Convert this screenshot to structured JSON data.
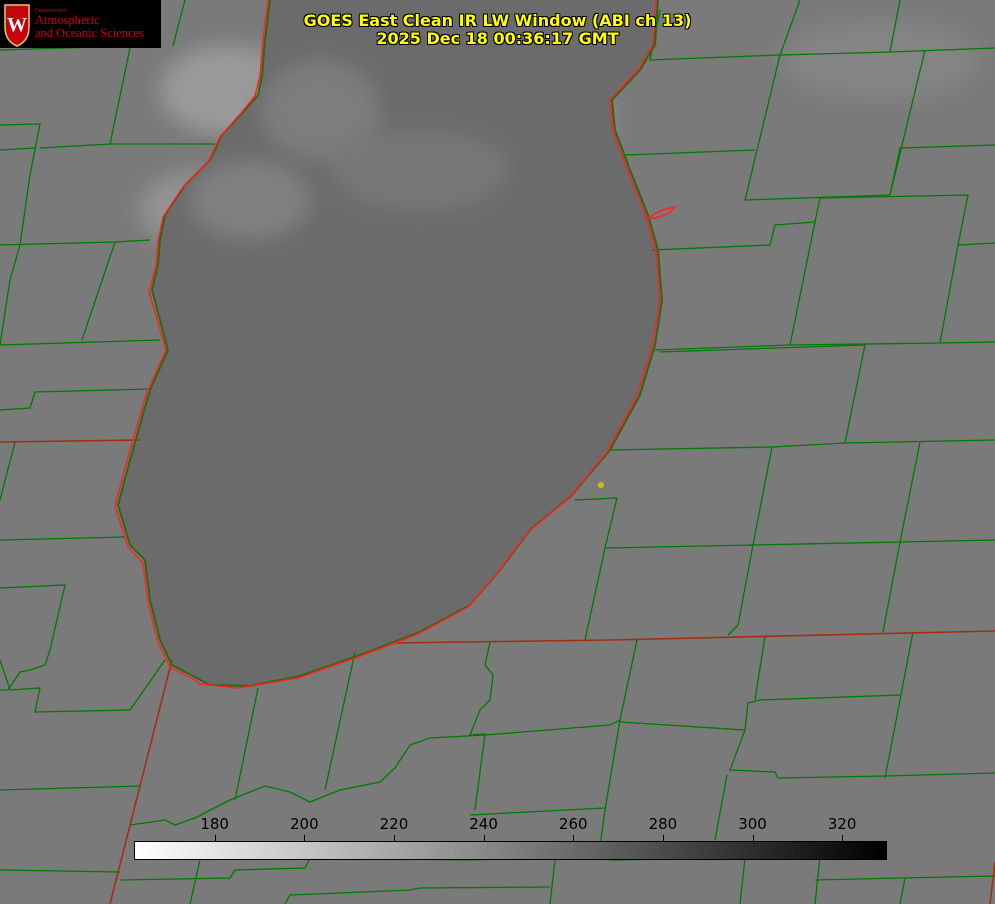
{
  "logo": {
    "dept_line": "Department of",
    "line1": "Atmospheric",
    "line2": "and Oceanic Sciences",
    "seal_letter": "W",
    "color": "#c5050c"
  },
  "title": {
    "line1": "GOES East Clean IR LW Window (ABI ch 13)",
    "line2": "2025 Dec 18 00:36:17 GMT",
    "color": "#ffff00"
  },
  "colorbar": {
    "ticks": [
      "180",
      "200",
      "220",
      "240",
      "260",
      "280",
      "300",
      "320"
    ],
    "min": 162,
    "max": 330,
    "cmap": "white-to-black"
  },
  "map": {
    "background": "#7a7a7a",
    "lake_color": "#6b6b6b",
    "county_line_color": "#007a00",
    "state_line_color": "#a03010",
    "coastline_color": "#ff2020",
    "marker_color": "#d4c000"
  }
}
